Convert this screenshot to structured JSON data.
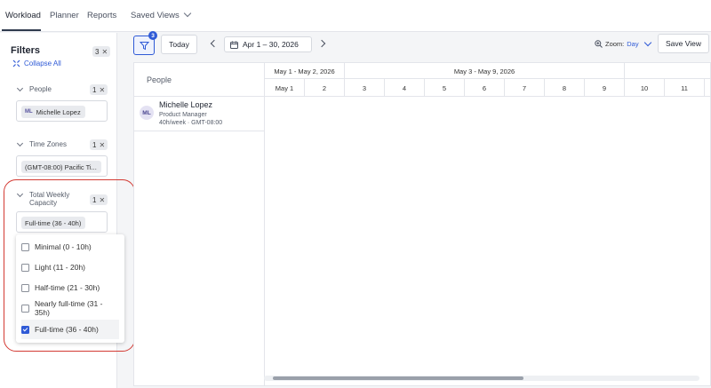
{
  "topnav": {
    "tabs": [
      "Workload",
      "Planner",
      "Reports"
    ],
    "saved_views": "Saved Views"
  },
  "sidebar": {
    "title": "Filters",
    "count": "3",
    "collapse_all": "Collapse All",
    "sections": {
      "people": {
        "label": "People",
        "count": "1",
        "chip_initials": "ML",
        "chip": "Michelle Lopez"
      },
      "timezones": {
        "label": "Time Zones",
        "count": "1",
        "chip": "(GMT-08:00) Pacific Ti..."
      },
      "capacity": {
        "label_line1": "Total Weekly",
        "label_line2": "Capacity",
        "count": "1",
        "chip": "Full-time (36 - 40h)"
      }
    },
    "dropdown": {
      "options": [
        {
          "label": "Minimal (0 - 10h)",
          "checked": false
        },
        {
          "label": "Light (11 - 20h)",
          "checked": false
        },
        {
          "label": "Half-time (21 - 30h)",
          "checked": false
        },
        {
          "label": "Nearly full-time (31 - 35h)",
          "checked": false
        },
        {
          "label": "Full-time (36 - 40h)",
          "checked": true
        }
      ]
    }
  },
  "toolbar": {
    "filter_count": "3",
    "today": "Today",
    "date_range": "Apr 1 – 30, 2026",
    "zoom_label": "Zoom:",
    "zoom_value": "Day",
    "save_view": "Save View"
  },
  "grid": {
    "people_header": "People",
    "person": {
      "initials": "ML",
      "name": "Michelle Lopez",
      "role": "Product Manager",
      "capacity": "40h/week · GMT-08:00"
    },
    "weeks": [
      "May 1 - May 2, 2026",
      "May 3 - May 9, 2026"
    ],
    "days": [
      "May 1",
      "2",
      "3",
      "4",
      "5",
      "6",
      "7",
      "8",
      "9",
      "10",
      "11"
    ]
  },
  "colors": {
    "accent": "#2f5ad6",
    "highlight_circle": "#d33a33"
  }
}
